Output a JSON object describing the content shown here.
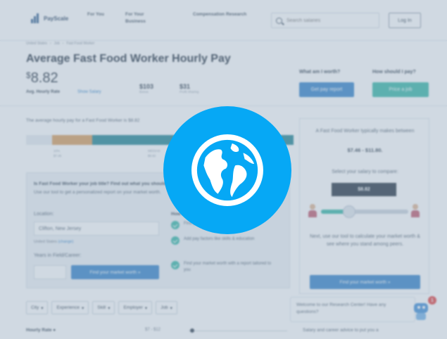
{
  "header": {
    "logo_text": "PayScale",
    "nav": [
      "For You",
      "For Your Business",
      "Compensation Research"
    ],
    "search_placeholder": "Search salaries",
    "login_label": "Log In"
  },
  "breadcrumb": [
    "United States",
    "Job",
    "Fast Food Worker"
  ],
  "title": "Average Fast Food Worker Hourly Pay",
  "pay": {
    "currency": "$",
    "amount": "8.82",
    "label": "Avg. Hourly Rate",
    "show_salary": "Show Salary",
    "stats": [
      {
        "value": "$103",
        "label": "Bonus"
      },
      {
        "value": "$31",
        "label": "Profit Sharing"
      }
    ]
  },
  "actions": {
    "worth_question": "What am I worth?",
    "get_pay_report": "Get pay report",
    "pay_question": "How should I pay?",
    "price_job": "Price a job"
  },
  "summary_text": "The average hourly pay for a Fast Food Worker is $8.82",
  "range_labels": [
    {
      "pct": "10%",
      "val": "$7.46"
    },
    {
      "pct": "MEDIAN",
      "val": "$8.82"
    }
  ],
  "card": {
    "title": "Is Fast Food Worker your job title? Find out what you should be paid",
    "subtitle": "Use our tool to get a personalized report on your market worth.",
    "location_label": "Location:",
    "location_value": "Clifton, New Jersey",
    "country_text": "United States",
    "change_link": "(change)",
    "years_label": "Years in Field/Career:",
    "find_button": "Find your market worth »",
    "steps_title": "How it works",
    "steps": [
      "Find your market worth",
      "Add pay factors like skills & education",
      "Find your market worth with a report tailored to you"
    ]
  },
  "panel": {
    "intro": "A Fast Food Worker typically makes between",
    "range": "$7.46 - $11.80.",
    "select_text": "Select your salary to compare:",
    "value": "$8.82",
    "slider_pct": 0.32,
    "next_text": "Next, use our tool to calculate your market worth & see where you stand among peers.",
    "button": "Find your market worth »"
  },
  "filters": [
    "City",
    "Experience",
    "Skill",
    "Employer",
    "Job"
  ],
  "hourly": {
    "label": "Hourly Rate",
    "range": "$7 - $12"
  },
  "bottom_right_text": "Salary and career advice to put you a",
  "chat": {
    "message": "Welcome to our Research Center! Have any questions?",
    "notification_count": "1"
  },
  "colors": {
    "accent_blue": "#2d7fc9",
    "teal": "#2fb5a3",
    "globe_badge": "#06a8f5",
    "bar_orange": "#d89a57",
    "bar_teal": "#19808f"
  }
}
